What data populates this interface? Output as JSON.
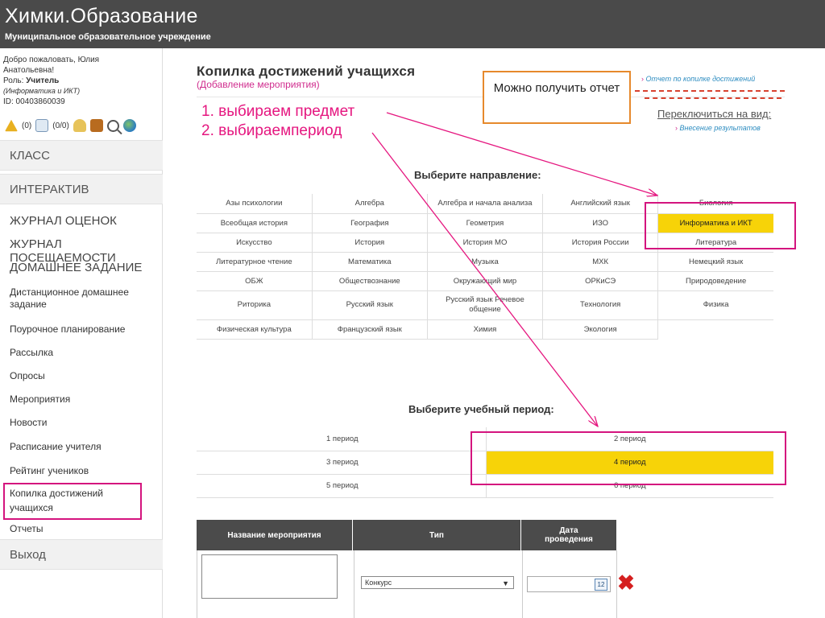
{
  "header": {
    "title": "Химки.Образование",
    "subtitle": "Муниципальное образовательное учреждение"
  },
  "user": {
    "greeting_line1": "Добро пожаловать, Юлия",
    "greeting_line2": "Анатольевна!",
    "role_label": "Роль:",
    "role": "Учитель",
    "subject_note": "(Информатика и ИКТ)",
    "id_line": "ID: 00403860039"
  },
  "icons": {
    "warn_count": "(0)",
    "mail_count": "(0/0)"
  },
  "sidebar": {
    "blocks": [
      "КЛАСС",
      "ИНТЕРАКТИВ",
      "Выход"
    ],
    "items": [
      "ЖУРНАЛ ОЦЕНОК",
      "ЖУРНАЛ ПОСЕЩАЕМОСТИ",
      "ДОМАШНЕЕ ЗАДАНИЕ",
      "Дистанционное домашнее задание",
      "Поурочное планирование",
      "Рассылка",
      "Опросы",
      "Мероприятия",
      "Новости",
      "Расписание учителя",
      "Рейтинг учеников",
      "Копилка достижений учащихся",
      "Отчеты"
    ]
  },
  "page": {
    "title": "Копилка достижений учащихся",
    "subtitle": "(Добавление мероприятия)",
    "report_link": "Отчет по копилке достижений",
    "switch_label": "Переключиться на вид:",
    "enter_results_link": "Внесение результатов"
  },
  "annotation": {
    "step1": "1.  выбираем предмет",
    "step2": "2.  выбираемпериод",
    "callout": "Можно получить отчет"
  },
  "subjects": {
    "heading": "Выберите направление:",
    "rows": [
      [
        "Азы психологии",
        "Алгебра",
        "Алгебра и начала анализа",
        "Английский язык",
        "Биология"
      ],
      [
        "Всеобщая история",
        "География",
        "Геометрия",
        "ИЗО",
        "Информатика и ИКТ"
      ],
      [
        "Искусство",
        "История",
        "История МО",
        "История России",
        "Литература"
      ],
      [
        "Литературное чтение",
        "Математика",
        "Музыка",
        "МХК",
        "Немецкий язык"
      ],
      [
        "ОБЖ",
        "Обществознание",
        "Окружающий мир",
        "ОРКиСЭ",
        "Природоведение"
      ],
      [
        "Риторика",
        "Русский язык",
        "Русский язык Речевое общение",
        "Технология",
        "Физика"
      ],
      [
        "Физическая культура",
        "Французский язык",
        "Химия",
        "Экология",
        ""
      ]
    ],
    "selected": "Информатика и ИКТ"
  },
  "periods": {
    "heading": "Выберите учебный период:",
    "rows": [
      [
        "1 период",
        "2 период"
      ],
      [
        "3 период",
        "4 период"
      ],
      [
        "5 период",
        "6 период"
      ]
    ],
    "selected": "4 период"
  },
  "form": {
    "col_name": "Название мероприятия",
    "col_type": "Тип",
    "col_date": "Дата проведения",
    "type_value": "Конкурс",
    "calendar_label": "12"
  },
  "colors": {
    "topbar": "#4a4a4a",
    "highlight": "#f7d308",
    "annotation_pink": "#e5167f",
    "callout_orange": "#e6892c"
  }
}
